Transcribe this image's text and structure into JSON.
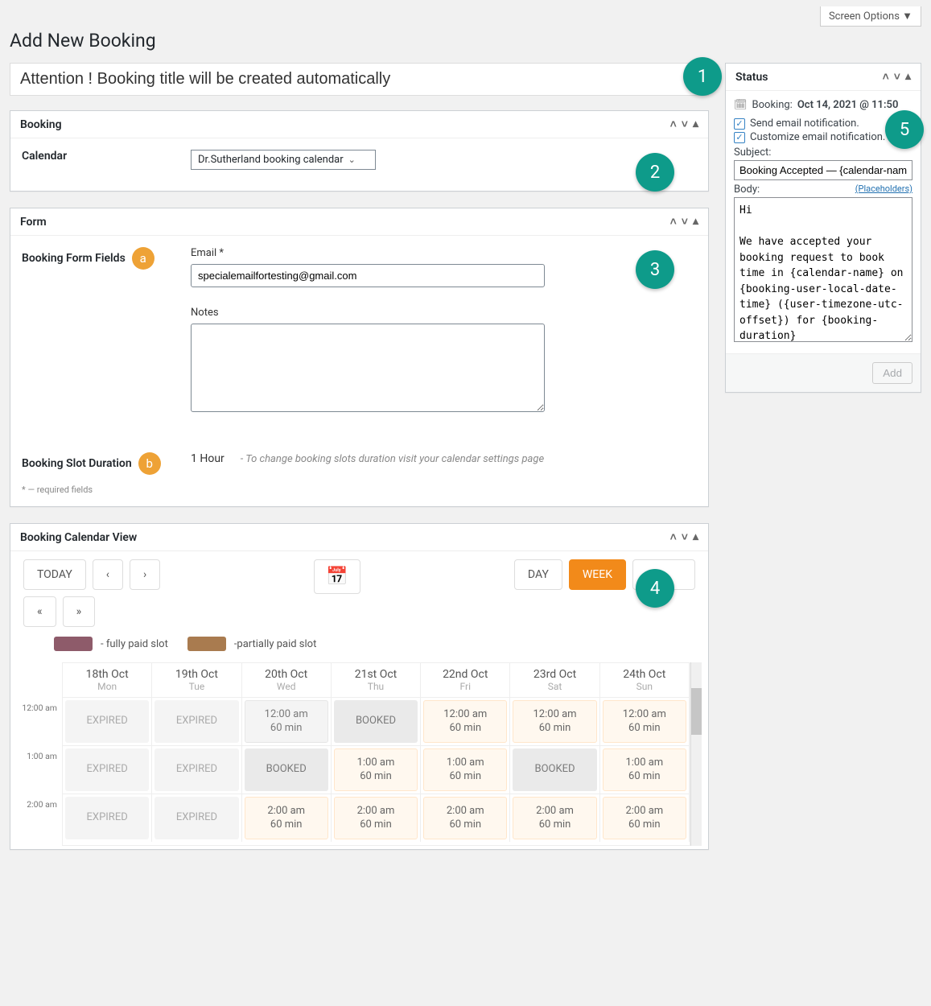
{
  "topbar": {
    "screen_options": "Screen Options ▼"
  },
  "page_title": "Add New Booking",
  "title_input_value": "Attention ! Booking title will be created automatically",
  "panels": {
    "booking": {
      "title": "Booking",
      "calendar_label": "Calendar",
      "calendar_value": "Dr.Sutherland booking calendar"
    },
    "form": {
      "title": "Form",
      "fields_label": "Booking Form Fields",
      "email_label": "Email *",
      "email_value": "specialemailfortesting@gmail.com",
      "notes_label": "Notes",
      "notes_value": "",
      "slot_duration_label": "Booking Slot Duration",
      "slot_duration_value": "1 Hour",
      "slot_duration_hint": "- To change booking slots duration visit your calendar settings page",
      "required_note": "* — required fields"
    },
    "calendar_view": {
      "title": "Booking Calendar View",
      "today": "TODAY",
      "prev": "‹",
      "next": "›",
      "prev_fast": "«",
      "next_fast": "»",
      "day": "DAY",
      "week": "WEEK",
      "month": "",
      "legend_full": "- fully paid slot",
      "legend_partial": "-partially paid slot",
      "days": [
        {
          "date": "18th Oct",
          "dow": "Mon"
        },
        {
          "date": "19th Oct",
          "dow": "Tue"
        },
        {
          "date": "20th Oct",
          "dow": "Wed"
        },
        {
          "date": "21st Oct",
          "dow": "Thu"
        },
        {
          "date": "22nd Oct",
          "dow": "Fri"
        },
        {
          "date": "23rd Oct",
          "dow": "Sat"
        },
        {
          "date": "24th Oct",
          "dow": "Sun"
        }
      ],
      "time_labels": [
        "12:00 am",
        "1:00 am",
        "2:00 am"
      ],
      "grid": [
        [
          {
            "t": "EXPIRED",
            "cls": "expired"
          },
          {
            "t": "EXPIRED",
            "cls": "expired"
          },
          {
            "t": "12:00 am\n60 min",
            "cls": "avail-grey"
          },
          {
            "t": "BOOKED",
            "cls": "booked"
          },
          {
            "t": "12:00 am\n60 min",
            "cls": "avail"
          },
          {
            "t": "12:00 am\n60 min",
            "cls": "avail"
          },
          {
            "t": "12:00 am\n60 min",
            "cls": "avail"
          }
        ],
        [
          {
            "t": "EXPIRED",
            "cls": "expired"
          },
          {
            "t": "EXPIRED",
            "cls": "expired"
          },
          {
            "t": "BOOKED",
            "cls": "booked"
          },
          {
            "t": "1:00 am\n60 min",
            "cls": "avail"
          },
          {
            "t": "1:00 am\n60 min",
            "cls": "avail"
          },
          {
            "t": "BOOKED",
            "cls": "booked"
          },
          {
            "t": "1:00 am\n60 min",
            "cls": "avail"
          }
        ],
        [
          {
            "t": "EXPIRED",
            "cls": "expired"
          },
          {
            "t": "EXPIRED",
            "cls": "expired"
          },
          {
            "t": "2:00 am\n60 min",
            "cls": "avail"
          },
          {
            "t": "2:00 am\n60 min",
            "cls": "avail"
          },
          {
            "t": "2:00 am\n60 min",
            "cls": "avail"
          },
          {
            "t": "2:00 am\n60 min",
            "cls": "avail"
          },
          {
            "t": "2:00 am\n60 min",
            "cls": "avail"
          }
        ]
      ]
    }
  },
  "sidebar": {
    "status_title": "Status",
    "booking_label": "Booking:",
    "booking_value": "Oct 14, 2021 @ 11:50",
    "send_email": "Send email notification.",
    "customize_email": "Customize email notification.",
    "subject_label": "Subject:",
    "subject_value": "Booking Accepted — {calendar-name} -",
    "body_label": "Body:",
    "placeholders_link": "(Placeholders)",
    "body_value": "Hi\n\nWe have accepted your booking request to book time in {calendar-name} on {booking-user-local-date-time} ({user-timezone-utc-offset}) for {booking-duration}\n\nPlease add this to your Google calendar {add-to-google-calendar}",
    "add_button": "Add"
  },
  "annotations": {
    "1": "1",
    "2": "2",
    "3": "3",
    "4": "4",
    "5": "5",
    "a": "a",
    "b": "b"
  },
  "colors": {
    "legend_full": "#8e5b6a",
    "legend_partial": "#a97b4f"
  }
}
